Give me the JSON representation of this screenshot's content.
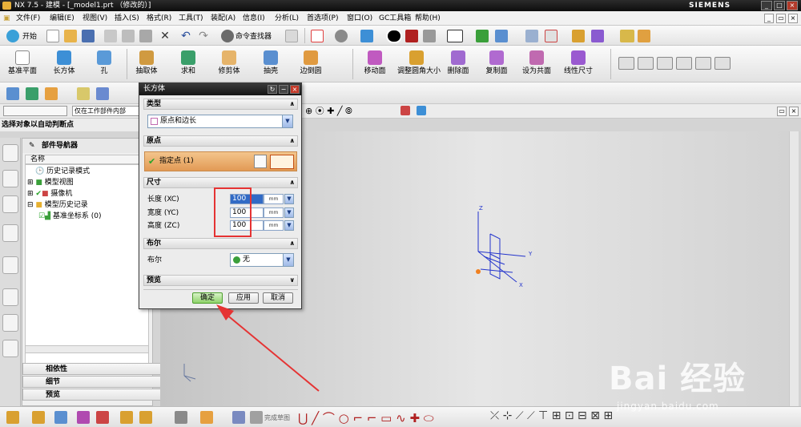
{
  "window": {
    "title": "NX 7.5 - 建模 - [_model1.prt （修改的）]",
    "brand": "SIEMENS"
  },
  "menu": {
    "start": "开始",
    "items": [
      "文件(F)",
      "编辑(E)",
      "视图(V)",
      "插入(S)",
      "格式(R)",
      "工具(T)",
      "装配(A)",
      "信息(I)",
      "分析(L)",
      "首选项(P)",
      "窗口(O)",
      "GC工具箱",
      "帮助(H)"
    ],
    "command_finder": "命令查找器"
  },
  "feature_toolbar": {
    "buttons": [
      "基准平面",
      "长方体",
      "孔",
      "抽取体",
      "求和",
      "修剪体",
      "抽壳",
      "边倒圆",
      "移动面",
      "调整圆角大小",
      "删除面",
      "复制面",
      "设为共面",
      "线性尺寸"
    ]
  },
  "selection_bar": {
    "scope": "仅在工作部件内部"
  },
  "status": "选择对象以自动判断点",
  "part_navigator": {
    "title": "部件导航器",
    "column": "名称",
    "items": [
      {
        "label": "历史记录模式"
      },
      {
        "label": "模型视图"
      },
      {
        "label": "摄像机"
      },
      {
        "label": "模型历史记录"
      },
      {
        "label": "基准坐标系 (0)"
      }
    ],
    "panels": [
      "相依性",
      "细节",
      "预览"
    ]
  },
  "dialog": {
    "title": "长方体",
    "sections": {
      "type": "类型",
      "origin": "原点",
      "dimensions": "尺寸",
      "boolean": "布尔",
      "preview": "预览"
    },
    "type_value": "原点和边长",
    "specify_point": "指定点 (1)",
    "length_label": "长度 (XC)",
    "width_label": "宽度 (YC)",
    "height_label": "高度 (ZC)",
    "length": "100",
    "width": "100",
    "height": "100",
    "unit": "mm",
    "boolean_label": "布尔",
    "boolean_value": "无",
    "ok": "确定",
    "apply": "应用",
    "cancel": "取消"
  },
  "viewport": {
    "axis_labels": {
      "z": "Z",
      "y": "Y",
      "x": "X"
    }
  },
  "bottom_toolbar": {
    "finish_sketch": "完成草图"
  },
  "watermark": {
    "brand": "Bai 经验",
    "url": "jingyan.baidu.com"
  },
  "colors": {
    "title_bg": "#1a1a1a",
    "accent_red": "#e53333",
    "ok_green": "#8fd26a",
    "axis_blue": "#2233cc"
  }
}
